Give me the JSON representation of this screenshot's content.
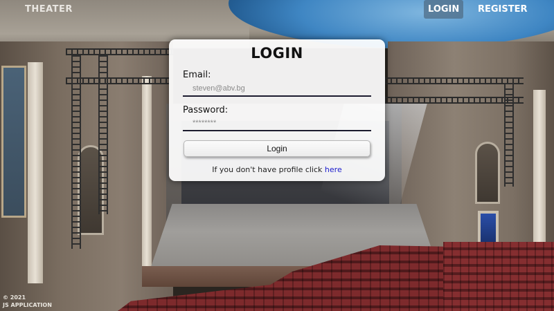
{
  "header": {
    "brand": "THEATER",
    "nav": {
      "login": "LOGIN",
      "register": "REGISTER"
    }
  },
  "login_form": {
    "title": "LOGIN",
    "email_label": "Email:",
    "email_placeholder": "steven@abv.bg",
    "password_label": "Password:",
    "password_placeholder": "********",
    "submit_label": "Login",
    "footnote_text": "If you don't have profile click ",
    "footnote_link": "here"
  },
  "footer": {
    "copyright": "© 2021",
    "app_name": "JS APPLICATION"
  },
  "colors": {
    "link": "#1a1acc",
    "active_nav_bg": "#506e87"
  }
}
